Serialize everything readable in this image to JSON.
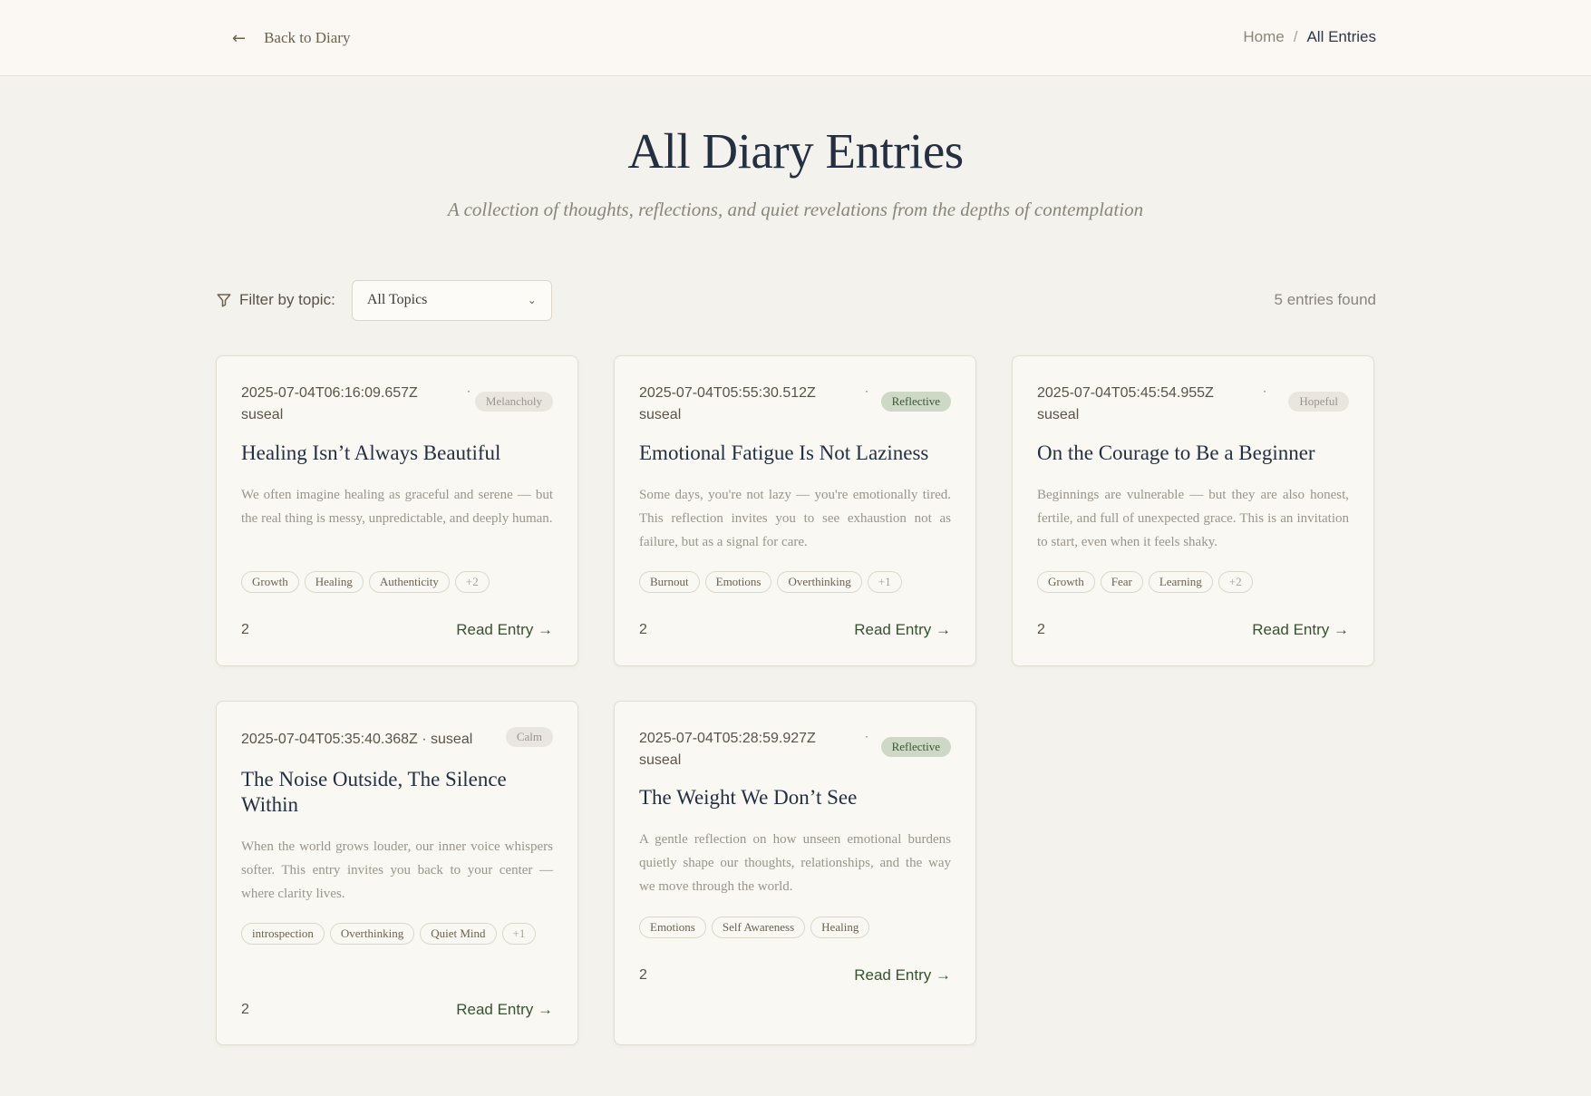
{
  "header": {
    "back_label": "Back to Diary",
    "breadcrumb_home": "Home",
    "breadcrumb_sep": "/",
    "breadcrumb_current": "All Entries"
  },
  "page": {
    "title": "All Diary Entries",
    "subtitle": "A collection of thoughts, reflections, and quiet revelations from the depths of contemplation"
  },
  "filter": {
    "label": "Filter by topic:",
    "selected": "All Topics",
    "entries_found": "5 entries found"
  },
  "entries": [
    {
      "date": "2025-07-04T06:16:09.657Z",
      "author": "suseal",
      "mood": "Melancholy",
      "title": "Healing Isn’t Always Beautiful",
      "excerpt": "We often imagine healing as graceful and serene — but the real thing is messy, unpredictable, and deeply human.",
      "tags": [
        "Growth",
        "Healing",
        "Authenticity",
        "+2"
      ],
      "count": "2",
      "read_label": "Read Entry →"
    },
    {
      "date": "2025-07-04T05:55:30.512Z",
      "author": "suseal",
      "mood": "Reflective",
      "title": "Emotional Fatigue Is Not Laziness",
      "excerpt": "Some days, you're not lazy — you're emotionally tired. This reflection invites you to see exhaustion not as failure, but as a signal for care.",
      "tags": [
        "Burnout",
        "Emotions",
        "Overthinking",
        "+1"
      ],
      "count": "2",
      "read_label": "Read Entry →"
    },
    {
      "date": "2025-07-04T05:45:54.955Z",
      "author": "suseal",
      "mood": "Hopeful",
      "title": "On the Courage to Be a Beginner",
      "excerpt": "Beginnings are vulnerable — but they are also honest, fertile, and full of unexpected grace. This is an invitation to start, even when it feels shaky.",
      "tags": [
        "Growth",
        "Fear",
        "Learning",
        "+2"
      ],
      "count": "2",
      "read_label": "Read Entry →"
    },
    {
      "date": "2025-07-04T05:35:40.368Z",
      "author": "suseal",
      "meta_line": "2025-07-04T05:35:40.368Z · suseal",
      "mood": "Calm",
      "title": "The Noise Outside, The Silence Within",
      "excerpt": "When the world grows louder, our inner voice whispers softer. This entry invites you back to your center — where clarity lives.",
      "tags": [
        "introspection",
        "Overthinking",
        "Quiet Mind",
        "+1"
      ],
      "count": "2",
      "read_label": "Read Entry →"
    },
    {
      "date": "2025-07-04T05:28:59.927Z",
      "author": "suseal",
      "mood": "Reflective",
      "title": "The Weight We Don’t See",
      "excerpt": "A gentle reflection on how unseen emotional burdens quietly shape our thoughts, relationships, and the way we move through the world.",
      "tags": [
        "Emotions",
        "Self Awareness",
        "Healing"
      ],
      "count": "2",
      "read_label": "Read Entry →"
    }
  ]
}
